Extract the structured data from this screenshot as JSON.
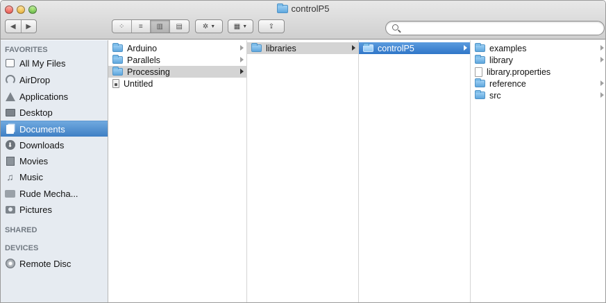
{
  "window": {
    "title": "controlP5"
  },
  "toolbar": {
    "back_icon": "back-arrow-icon",
    "forward_icon": "forward-arrow-icon",
    "view_modes": [
      "icon-view-icon",
      "list-view-icon",
      "column-view-icon",
      "coverflow-view-icon"
    ],
    "active_view": "column",
    "action_icon": "gear-icon",
    "arrange_icon": "arrange-grid-icon",
    "share_icon": "share-icon",
    "search_value": ""
  },
  "sidebar": {
    "favorites_heading": "FAVORITES",
    "favorites": [
      {
        "label": "All My Files",
        "icon": "all-files-icon"
      },
      {
        "label": "AirDrop",
        "icon": "airdrop-icon"
      },
      {
        "label": "Applications",
        "icon": "applications-icon"
      },
      {
        "label": "Desktop",
        "icon": "desktop-icon"
      },
      {
        "label": "Documents",
        "icon": "documents-icon",
        "selected": true
      },
      {
        "label": "Downloads",
        "icon": "downloads-icon"
      },
      {
        "label": "Movies",
        "icon": "movies-icon"
      },
      {
        "label": "Music",
        "icon": "music-icon"
      },
      {
        "label": "Rude Mecha...",
        "icon": "folder-icon"
      },
      {
        "label": "Pictures",
        "icon": "pictures-icon"
      }
    ],
    "shared_heading": "SHARED",
    "devices_heading": "DEVICES",
    "devices": [
      {
        "label": "Remote Disc",
        "icon": "remote-disc-icon"
      }
    ]
  },
  "columns": [
    {
      "items": [
        {
          "label": "Arduino",
          "type": "folder",
          "has_children": true
        },
        {
          "label": "Parallels",
          "type": "folder",
          "has_children": true
        },
        {
          "label": "Processing",
          "type": "folder",
          "has_children": true,
          "state": "path"
        },
        {
          "label": "Untitled",
          "type": "file",
          "has_children": false
        }
      ]
    },
    {
      "items": [
        {
          "label": "libraries",
          "type": "folder",
          "has_children": true,
          "state": "path"
        }
      ]
    },
    {
      "items": [
        {
          "label": "controlP5",
          "type": "folder",
          "has_children": true,
          "state": "selected"
        }
      ]
    },
    {
      "items": [
        {
          "label": "examples",
          "type": "folder",
          "has_children": true
        },
        {
          "label": "library",
          "type": "folder",
          "has_children": true
        },
        {
          "label": "library.properties",
          "type": "document",
          "has_children": false
        },
        {
          "label": "reference",
          "type": "folder",
          "has_children": true
        },
        {
          "label": "src",
          "type": "folder",
          "has_children": true
        }
      ]
    }
  ],
  "colors": {
    "selection_blue": "#3f7fc4",
    "path_gray": "#d4d4d4",
    "sidebar_bg": "#e6ebf1"
  }
}
